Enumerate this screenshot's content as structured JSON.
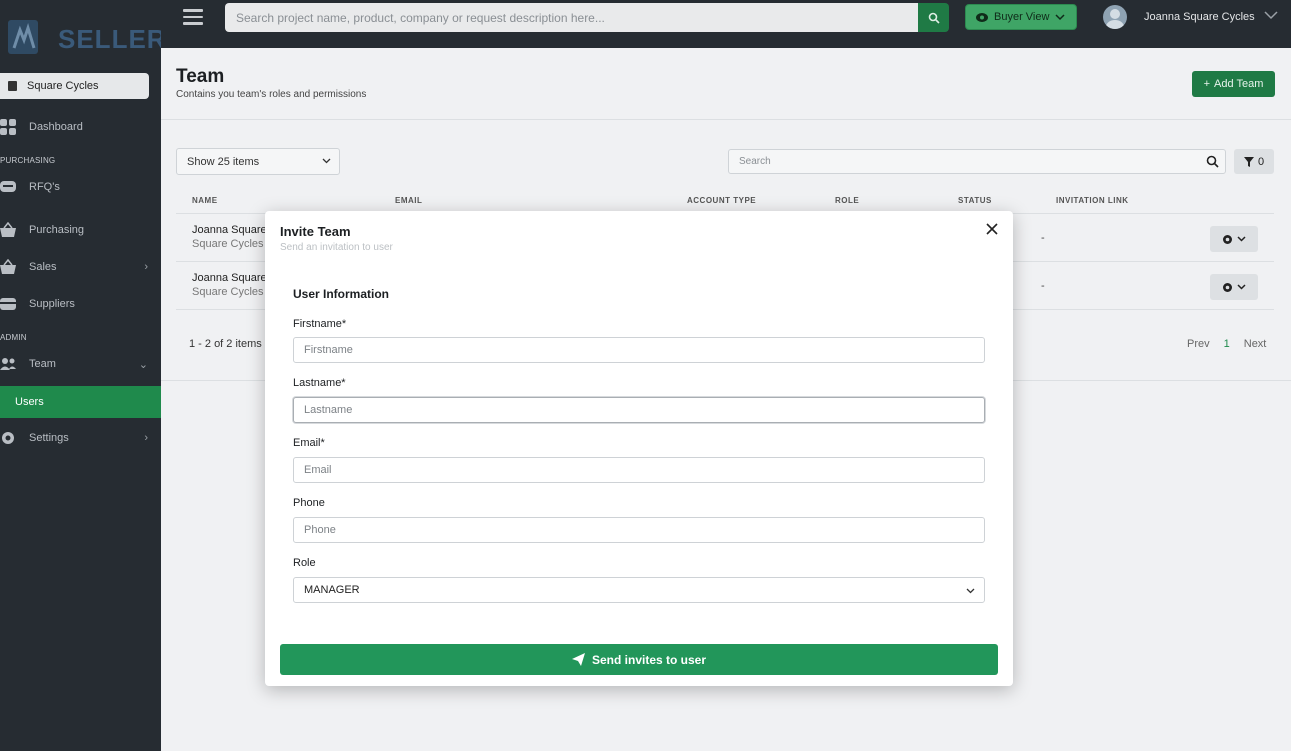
{
  "sidebar": {
    "logo_text": "SELLER",
    "org_name": "Square Cycles",
    "items": [
      {
        "label": "Dashboard"
      },
      {
        "section": "PURCHASING"
      },
      {
        "label": "RFQ's"
      },
      {
        "label": "Purchasing"
      },
      {
        "label": "Sales"
      },
      {
        "label": "Suppliers"
      },
      {
        "section": "ADMIN"
      },
      {
        "label": "Team"
      },
      {
        "label": "Users"
      },
      {
        "label": "Settings"
      }
    ]
  },
  "topbar": {
    "search_placeholder": "Search project name, product, company or request description here...",
    "buyer_view_label": "Buyer View",
    "user_name": "Joanna Square Cycles"
  },
  "page": {
    "title": "Team",
    "subtitle": "Contains you team's roles and permissions",
    "add_button": "Add Team"
  },
  "table": {
    "show_select": "Show 25 items",
    "search_placeholder": "Search",
    "filter_count": "0",
    "columns": [
      "NAME",
      "EMAIL",
      "ACCOUNT TYPE",
      "ROLE",
      "STATUS",
      "INVITATION LINK"
    ],
    "rows": [
      {
        "name": "Joanna Square",
        "company": "Square Cycles",
        "link": "-"
      },
      {
        "name": "Joanna Square",
        "company": "Square Cycles",
        "link": "-"
      }
    ],
    "pager_count": "1 - 2 of 2 items",
    "pager_prev": "Prev",
    "pager_current": "1",
    "pager_next": "Next"
  },
  "modal": {
    "title": "Invite Team",
    "subtitle": "Send an invitation to user",
    "section": "User Information",
    "fields": {
      "firstname": {
        "label": "Firstname*",
        "placeholder": "Firstname"
      },
      "lastname": {
        "label": "Lastname*",
        "placeholder": "Lastname"
      },
      "email": {
        "label": "Email*",
        "placeholder": "Email"
      },
      "phone": {
        "label": "Phone",
        "placeholder": "Phone"
      },
      "role": {
        "label": "Role",
        "value": "MANAGER"
      }
    },
    "submit_label": "Send invites to user"
  },
  "colors": {
    "sidebar_bg": "#262c32",
    "accent_green": "#1f8a4c",
    "button_green": "#22965a"
  }
}
